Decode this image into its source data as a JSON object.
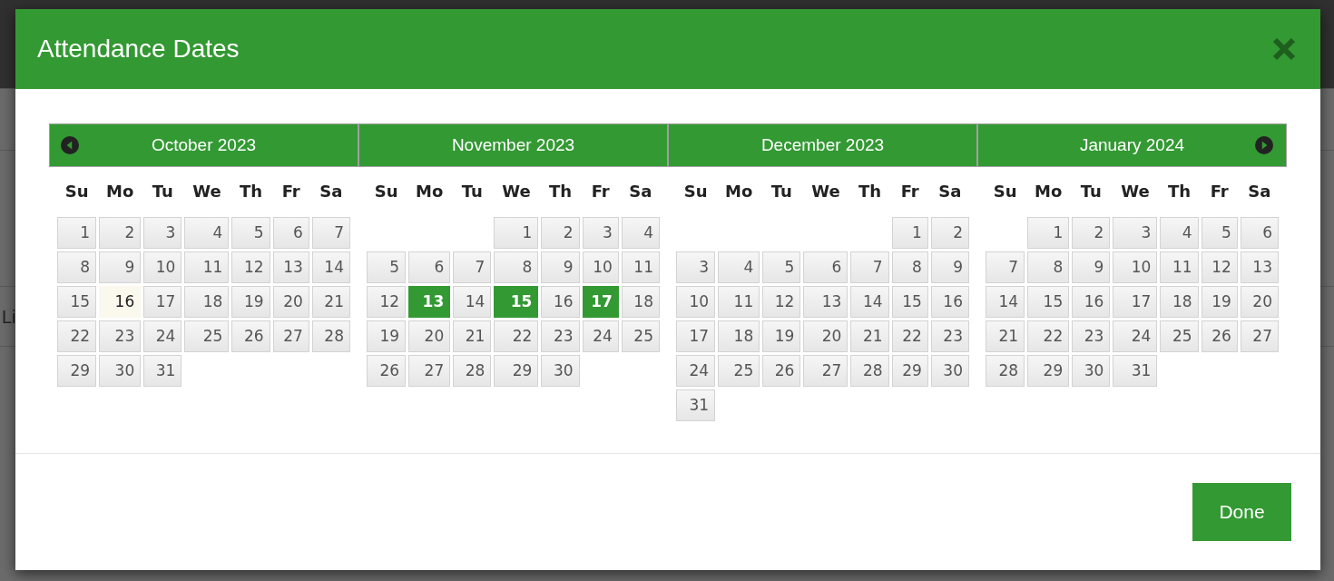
{
  "background": {
    "row_text": "Li"
  },
  "dialog": {
    "title": "Attendance Dates",
    "months": [
      {
        "title": "October 2023",
        "prev_button": true,
        "next_button": false,
        "weekdays": [
          "Su",
          "Mo",
          "Tu",
          "We",
          "Th",
          "Fr",
          "Sa"
        ],
        "weeks": [
          [
            {
              "kind": "day",
              "day": "1",
              "selected": false
            },
            {
              "kind": "day",
              "day": "2",
              "selected": false
            },
            {
              "kind": "day",
              "day": "3",
              "selected": false
            },
            {
              "kind": "day",
              "day": "4",
              "selected": false
            },
            {
              "kind": "day",
              "day": "5",
              "selected": false
            },
            {
              "kind": "day",
              "day": "6",
              "selected": false
            },
            {
              "kind": "day",
              "day": "7",
              "selected": false
            }
          ],
          [
            {
              "kind": "day",
              "day": "8",
              "selected": false
            },
            {
              "kind": "day",
              "day": "9",
              "selected": false
            },
            {
              "kind": "day",
              "day": "10",
              "selected": false
            },
            {
              "kind": "day",
              "day": "11",
              "selected": false
            },
            {
              "kind": "day",
              "day": "12",
              "selected": false
            },
            {
              "kind": "day",
              "day": "13",
              "selected": false
            },
            {
              "kind": "day",
              "day": "14",
              "selected": false
            }
          ],
          [
            {
              "kind": "day",
              "day": "15",
              "selected": false
            },
            {
              "kind": "today",
              "day": "16",
              "selected": false
            },
            {
              "kind": "day",
              "day": "17",
              "selected": false
            },
            {
              "kind": "day",
              "day": "18",
              "selected": false
            },
            {
              "kind": "day",
              "day": "19",
              "selected": false
            },
            {
              "kind": "day",
              "day": "20",
              "selected": false
            },
            {
              "kind": "day",
              "day": "21",
              "selected": false
            }
          ],
          [
            {
              "kind": "day",
              "day": "22",
              "selected": false
            },
            {
              "kind": "day",
              "day": "23",
              "selected": false
            },
            {
              "kind": "day",
              "day": "24",
              "selected": false
            },
            {
              "kind": "day",
              "day": "25",
              "selected": false
            },
            {
              "kind": "day",
              "day": "26",
              "selected": false
            },
            {
              "kind": "day",
              "day": "27",
              "selected": false
            },
            {
              "kind": "day",
              "day": "28",
              "selected": false
            }
          ],
          [
            {
              "kind": "day",
              "day": "29",
              "selected": false
            },
            {
              "kind": "day",
              "day": "30",
              "selected": false
            },
            {
              "kind": "day",
              "day": "31",
              "selected": false
            }
          ]
        ]
      },
      {
        "title": "November 2023",
        "prev_button": false,
        "next_button": false,
        "weekdays": [
          "Su",
          "Mo",
          "Tu",
          "We",
          "Th",
          "Fr",
          "Sa"
        ],
        "weeks": [
          [
            {
              "kind": "empty"
            },
            {
              "kind": "empty"
            },
            {
              "kind": "empty"
            },
            {
              "kind": "day",
              "day": "1",
              "selected": false
            },
            {
              "kind": "day",
              "day": "2",
              "selected": false
            },
            {
              "kind": "day",
              "day": "3",
              "selected": false
            },
            {
              "kind": "day",
              "day": "4",
              "selected": false
            }
          ],
          [
            {
              "kind": "day",
              "day": "5",
              "selected": false
            },
            {
              "kind": "day",
              "day": "6",
              "selected": false
            },
            {
              "kind": "day",
              "day": "7",
              "selected": false
            },
            {
              "kind": "day",
              "day": "8",
              "selected": false
            },
            {
              "kind": "day",
              "day": "9",
              "selected": false
            },
            {
              "kind": "day",
              "day": "10",
              "selected": false
            },
            {
              "kind": "day",
              "day": "11",
              "selected": false
            }
          ],
          [
            {
              "kind": "day",
              "day": "12",
              "selected": false
            },
            {
              "kind": "day",
              "day": "13",
              "selected": true
            },
            {
              "kind": "day",
              "day": "14",
              "selected": false
            },
            {
              "kind": "day",
              "day": "15",
              "selected": true
            },
            {
              "kind": "day",
              "day": "16",
              "selected": false
            },
            {
              "kind": "day",
              "day": "17",
              "selected": true
            },
            {
              "kind": "day",
              "day": "18",
              "selected": false
            }
          ],
          [
            {
              "kind": "day",
              "day": "19",
              "selected": false
            },
            {
              "kind": "day",
              "day": "20",
              "selected": false
            },
            {
              "kind": "day",
              "day": "21",
              "selected": false
            },
            {
              "kind": "day",
              "day": "22",
              "selected": false
            },
            {
              "kind": "day",
              "day": "23",
              "selected": false
            },
            {
              "kind": "day",
              "day": "24",
              "selected": false
            },
            {
              "kind": "day",
              "day": "25",
              "selected": false
            }
          ],
          [
            {
              "kind": "day",
              "day": "26",
              "selected": false
            },
            {
              "kind": "day",
              "day": "27",
              "selected": false
            },
            {
              "kind": "day",
              "day": "28",
              "selected": false
            },
            {
              "kind": "day",
              "day": "29",
              "selected": false
            },
            {
              "kind": "day",
              "day": "30",
              "selected": false
            }
          ]
        ]
      },
      {
        "title": "December 2023",
        "prev_button": false,
        "next_button": false,
        "weekdays": [
          "Su",
          "Mo",
          "Tu",
          "We",
          "Th",
          "Fr",
          "Sa"
        ],
        "weeks": [
          [
            {
              "kind": "empty"
            },
            {
              "kind": "empty"
            },
            {
              "kind": "empty"
            },
            {
              "kind": "empty"
            },
            {
              "kind": "empty"
            },
            {
              "kind": "day",
              "day": "1",
              "selected": false
            },
            {
              "kind": "day",
              "day": "2",
              "selected": false
            }
          ],
          [
            {
              "kind": "day",
              "day": "3",
              "selected": false
            },
            {
              "kind": "day",
              "day": "4",
              "selected": false
            },
            {
              "kind": "day",
              "day": "5",
              "selected": false
            },
            {
              "kind": "day",
              "day": "6",
              "selected": false
            },
            {
              "kind": "day",
              "day": "7",
              "selected": false
            },
            {
              "kind": "day",
              "day": "8",
              "selected": false
            },
            {
              "kind": "day",
              "day": "9",
              "selected": false
            }
          ],
          [
            {
              "kind": "day",
              "day": "10",
              "selected": false
            },
            {
              "kind": "day",
              "day": "11",
              "selected": false
            },
            {
              "kind": "day",
              "day": "12",
              "selected": false
            },
            {
              "kind": "day",
              "day": "13",
              "selected": false
            },
            {
              "kind": "day",
              "day": "14",
              "selected": false
            },
            {
              "kind": "day",
              "day": "15",
              "selected": false
            },
            {
              "kind": "day",
              "day": "16",
              "selected": false
            }
          ],
          [
            {
              "kind": "day",
              "day": "17",
              "selected": false
            },
            {
              "kind": "day",
              "day": "18",
              "selected": false
            },
            {
              "kind": "day",
              "day": "19",
              "selected": false
            },
            {
              "kind": "day",
              "day": "20",
              "selected": false
            },
            {
              "kind": "day",
              "day": "21",
              "selected": false
            },
            {
              "kind": "day",
              "day": "22",
              "selected": false
            },
            {
              "kind": "day",
              "day": "23",
              "selected": false
            }
          ],
          [
            {
              "kind": "day",
              "day": "24",
              "selected": false
            },
            {
              "kind": "day",
              "day": "25",
              "selected": false
            },
            {
              "kind": "day",
              "day": "26",
              "selected": false
            },
            {
              "kind": "day",
              "day": "27",
              "selected": false
            },
            {
              "kind": "day",
              "day": "28",
              "selected": false
            },
            {
              "kind": "day",
              "day": "29",
              "selected": false
            },
            {
              "kind": "day",
              "day": "30",
              "selected": false
            }
          ],
          [
            {
              "kind": "day",
              "day": "31",
              "selected": false
            }
          ]
        ]
      },
      {
        "title": "January 2024",
        "prev_button": false,
        "next_button": true,
        "weekdays": [
          "Su",
          "Mo",
          "Tu",
          "We",
          "Th",
          "Fr",
          "Sa"
        ],
        "weeks": [
          [
            {
              "kind": "empty"
            },
            {
              "kind": "day",
              "day": "1",
              "selected": false
            },
            {
              "kind": "day",
              "day": "2",
              "selected": false
            },
            {
              "kind": "day",
              "day": "3",
              "selected": false
            },
            {
              "kind": "day",
              "day": "4",
              "selected": false
            },
            {
              "kind": "day",
              "day": "5",
              "selected": false
            },
            {
              "kind": "day",
              "day": "6",
              "selected": false
            }
          ],
          [
            {
              "kind": "day",
              "day": "7",
              "selected": false
            },
            {
              "kind": "day",
              "day": "8",
              "selected": false
            },
            {
              "kind": "day",
              "day": "9",
              "selected": false
            },
            {
              "kind": "day",
              "day": "10",
              "selected": false
            },
            {
              "kind": "day",
              "day": "11",
              "selected": false
            },
            {
              "kind": "day",
              "day": "12",
              "selected": false
            },
            {
              "kind": "day",
              "day": "13",
              "selected": false
            }
          ],
          [
            {
              "kind": "day",
              "day": "14",
              "selected": false
            },
            {
              "kind": "day",
              "day": "15",
              "selected": false
            },
            {
              "kind": "day",
              "day": "16",
              "selected": false
            },
            {
              "kind": "day",
              "day": "17",
              "selected": false
            },
            {
              "kind": "day",
              "day": "18",
              "selected": false
            },
            {
              "kind": "day",
              "day": "19",
              "selected": false
            },
            {
              "kind": "day",
              "day": "20",
              "selected": false
            }
          ],
          [
            {
              "kind": "day",
              "day": "21",
              "selected": false
            },
            {
              "kind": "day",
              "day": "22",
              "selected": false
            },
            {
              "kind": "day",
              "day": "23",
              "selected": false
            },
            {
              "kind": "day",
              "day": "24",
              "selected": false
            },
            {
              "kind": "day",
              "day": "25",
              "selected": false
            },
            {
              "kind": "day",
              "day": "26",
              "selected": false
            },
            {
              "kind": "day",
              "day": "27",
              "selected": false
            }
          ],
          [
            {
              "kind": "day",
              "day": "28",
              "selected": false
            },
            {
              "kind": "day",
              "day": "29",
              "selected": false
            },
            {
              "kind": "day",
              "day": "30",
              "selected": false
            },
            {
              "kind": "day",
              "day": "31",
              "selected": false
            }
          ]
        ]
      }
    ],
    "done_button": "Done"
  }
}
